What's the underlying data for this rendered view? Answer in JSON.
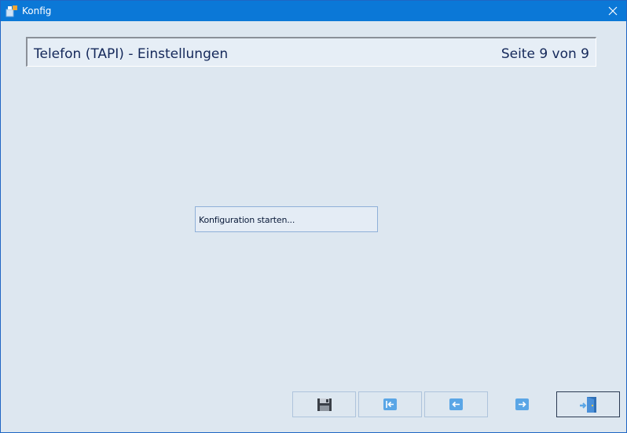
{
  "window": {
    "title": "Konfig"
  },
  "header": {
    "title": "Telefon (TAPI) - Einstellungen",
    "page_counter": "Seite 9 von 9"
  },
  "main": {
    "start_button_label": "Konfiguration starten..."
  },
  "nav": {
    "save_icon": "floppy-disk-icon",
    "first_icon": "first-page-arrow-icon",
    "back_icon": "arrow-left-icon",
    "next_icon": "arrow-right-icon",
    "exit_icon": "exit-door-icon"
  },
  "colors": {
    "titlebar": "#0b78d7",
    "background": "#dde7f0",
    "header_text": "#14285a",
    "arrow_icon": "#5aa6e6"
  }
}
